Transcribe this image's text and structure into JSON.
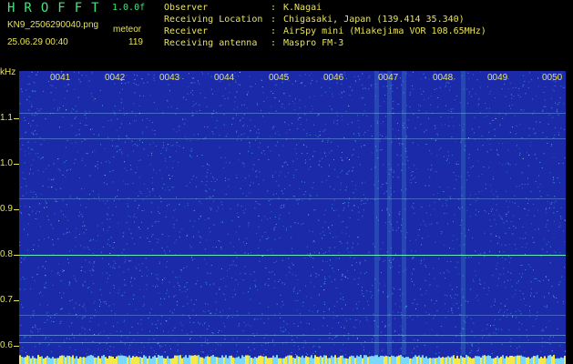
{
  "header": {
    "app_title": "HROFFT",
    "version": "1.0.0f",
    "filename": "KN9_2506290040.png",
    "meteor_label": "meteor",
    "datetime": "25.06.29 00:40",
    "count": "119"
  },
  "meta": [
    {
      "key": "Observer",
      "value": "K.Nagai"
    },
    {
      "key": "Receiving Location",
      "value": "Chigasaki, Japan (139.414 35.340)"
    },
    {
      "key": "Receiver",
      "value": "AirSpy mini (Miakejima VOR 108.65MHz)"
    },
    {
      "key": "Receiving antenna",
      "value": "Maspro FM-3"
    }
  ],
  "plot": {
    "unit": "kHz",
    "y_labels": [
      "1.1",
      "1.0",
      "0.9",
      "0.8",
      "0.7",
      "0.6"
    ],
    "x_labels": [
      "0041",
      "0042",
      "0043",
      "0044",
      "0045",
      "0046",
      "0047",
      "0048",
      "0049",
      "0050"
    ],
    "colors": {
      "background": "#1a2aa8",
      "noise": "#4fb6ff",
      "text": "#e8e35a",
      "accent": "#3fe67a"
    }
  }
}
